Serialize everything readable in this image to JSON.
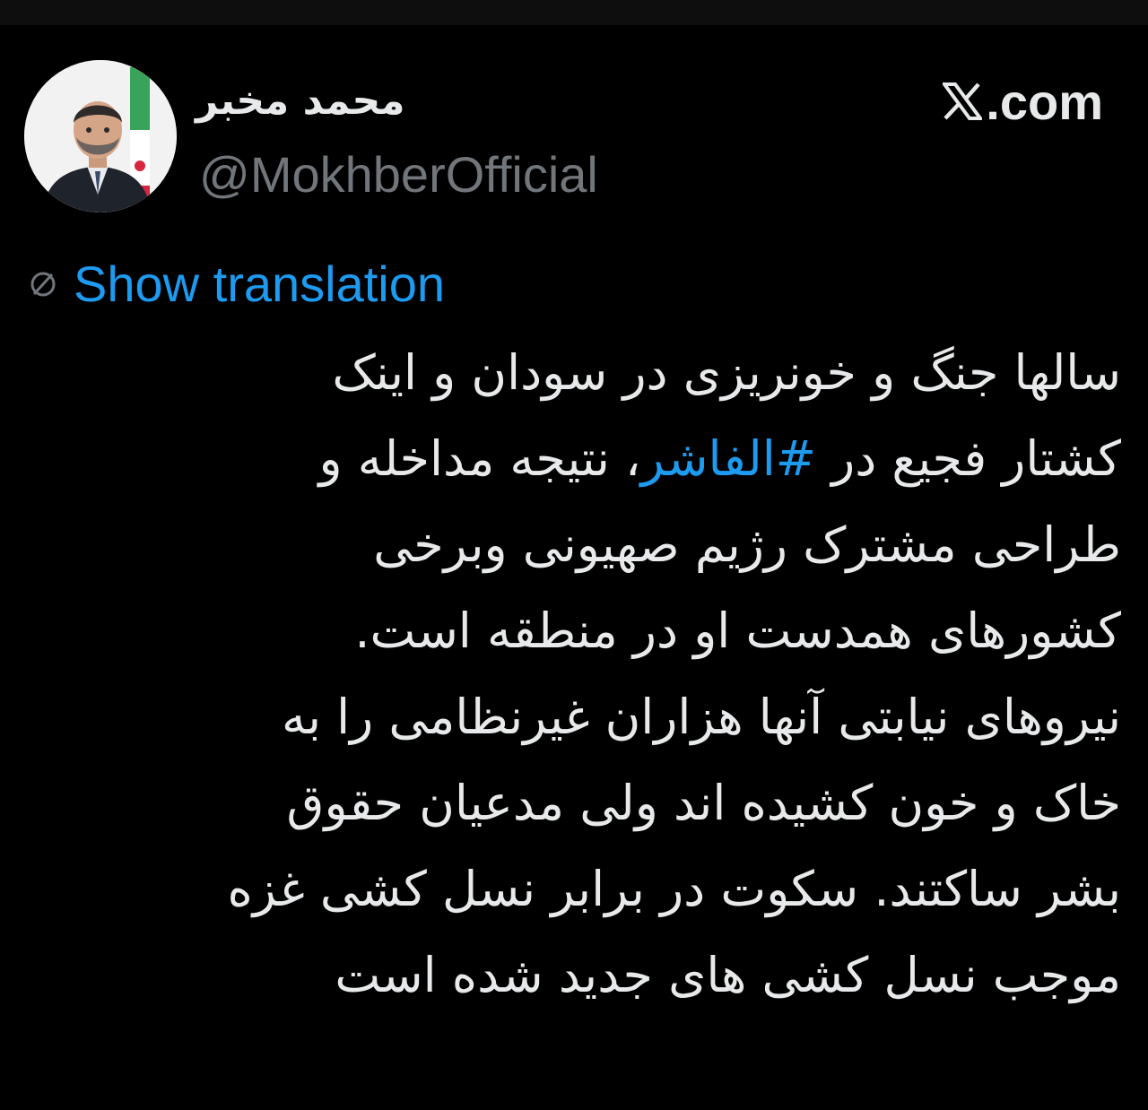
{
  "author": {
    "display_name": "محمد مخبر",
    "handle": "@MokhberOfficial",
    "avatar_icon": "user-avatar-photo"
  },
  "brand": {
    "label": ".com",
    "icon": "x-logo-icon"
  },
  "translation": {
    "icon": "translate-globe-icon",
    "link_text": "Show translation",
    "link_color": "#1d9bf0"
  },
  "tweet": {
    "lines": [
      "سالها جنگ و خونریزی در سودان و اینک",
      {
        "before": "کشتار فجیع در ",
        "hashtag": "#الفاشر",
        "after": "، نتیجه مداخله و"
      },
      "طراحی مشترک رژیم صهیونی وبرخی",
      "کشورهای همدست او در منطقه است.",
      "نیروهای نیابتی آنها هزاران غیرنظامی را به",
      "خاک و خون کشیده اند ولی مدعیان حقوق",
      "بشر ساکتند. سکوت در برابر نسل کشی غزه",
      "موجب نسل کشی های جدید شده است"
    ],
    "text_color": "#e7e9ea",
    "hashtag_color": "#1d9bf0"
  },
  "colors": {
    "background": "#000000",
    "secondary_text": "#71767b"
  }
}
